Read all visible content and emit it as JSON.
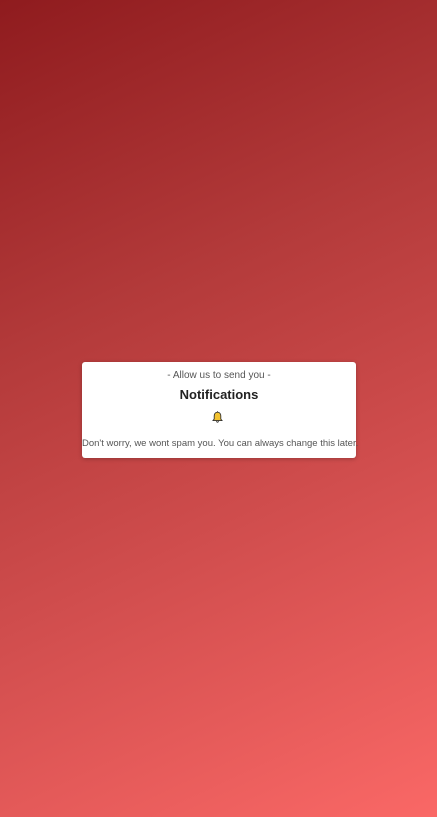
{
  "dialog": {
    "subtitle": "- Allow us to send you -",
    "title": "Notifications",
    "icon": "bell-icon",
    "note": "Don't worry, we wont spam you. You can always change this later."
  },
  "colors": {
    "background_start": "#8f1b1e",
    "background_end": "#fa6866",
    "bell_fill": "#f2c230"
  }
}
